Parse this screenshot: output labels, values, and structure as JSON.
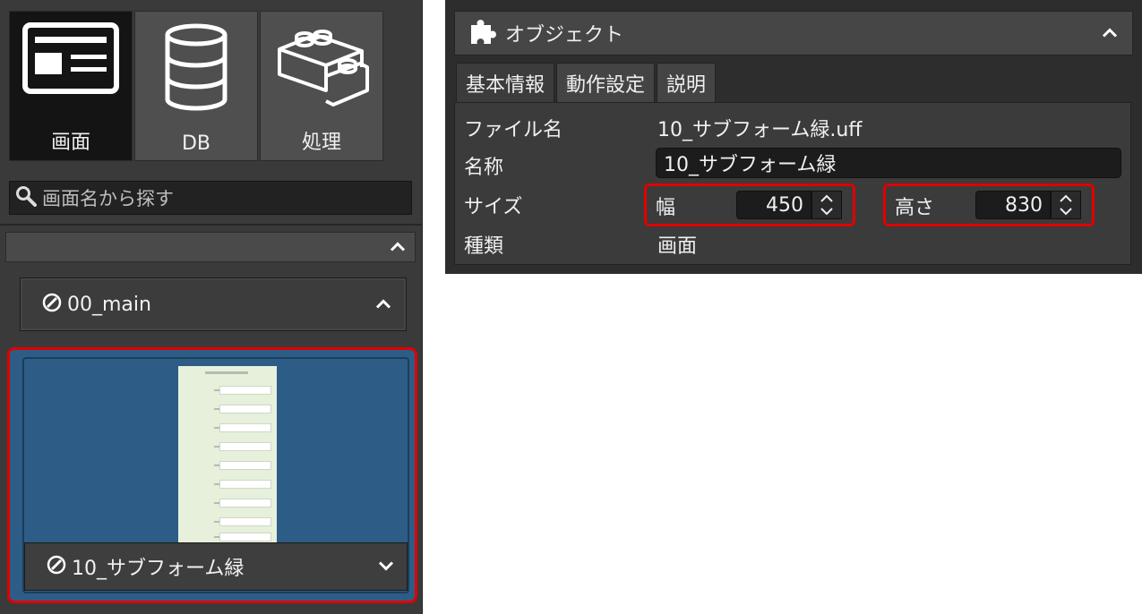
{
  "left_panel": {
    "tools": [
      {
        "label": "画面",
        "icon": "screen-layout-icon",
        "active": true
      },
      {
        "label": "DB",
        "icon": "database-icon",
        "active": false
      },
      {
        "label": "処理",
        "icon": "blocks-icon",
        "active": false
      }
    ],
    "search": {
      "placeholder": "画面名から探す"
    },
    "folder": {
      "label": "00_main"
    },
    "screen_item": {
      "label": "10_サブフォーム緑"
    }
  },
  "properties": {
    "header_title": "オブジェクト",
    "tabs": [
      "基本情報",
      "動作設定",
      "説明"
    ],
    "rows": {
      "file_name_label": "ファイル名",
      "file_name_value": "10_サブフォーム緑.uff",
      "name_label": "名称",
      "name_value": "10_サブフォーム緑",
      "size_label": "サイズ",
      "width_label": "幅",
      "width_value": "450",
      "height_label": "高さ",
      "height_value": "830",
      "type_label": "種類",
      "type_value": "画面"
    }
  },
  "colors": {
    "highlight": "#e00000",
    "selected_bg": "#2d5d86"
  }
}
